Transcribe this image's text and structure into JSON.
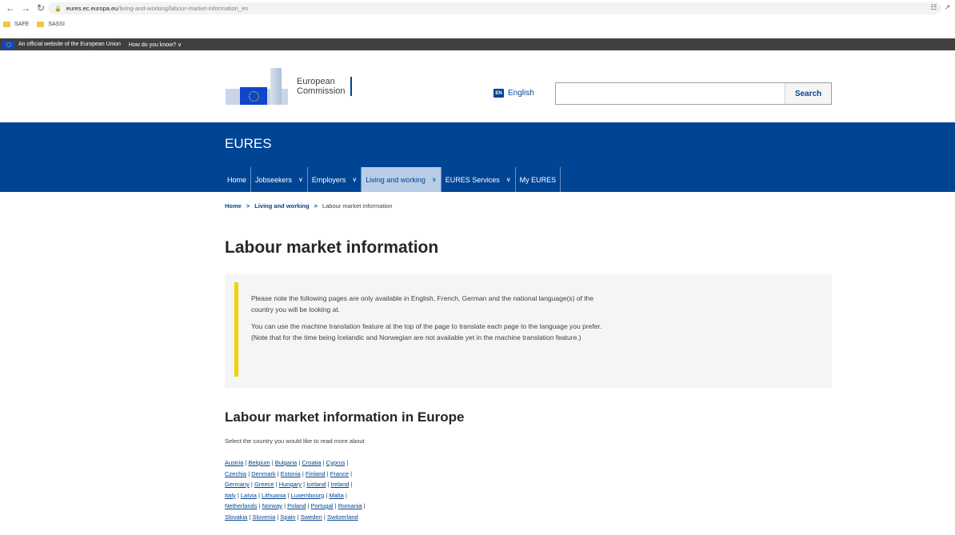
{
  "browser": {
    "url_host": "eures.ec.europa.eu",
    "url_path": "/living-and-working/labour-market-information_en",
    "bookmarks": [
      "SAFE",
      "SASSI"
    ]
  },
  "eu_bar": {
    "official_text": "An official website of the European Union",
    "how_know": "How do you know? ∨"
  },
  "header": {
    "logo_line1": "European",
    "logo_line2": "Commission",
    "lang_code": "EN",
    "lang_label": "English",
    "search_placeholder": "",
    "search_button": "Search"
  },
  "site": {
    "name": "EURES",
    "nav": [
      {
        "label": "Home",
        "dropdown": false
      },
      {
        "label": "Jobseekers",
        "dropdown": true
      },
      {
        "label": "Employers",
        "dropdown": true
      },
      {
        "label": "Living and working",
        "dropdown": true
      },
      {
        "label": "EURES Services",
        "dropdown": true
      },
      {
        "label": "My EURES",
        "dropdown": false
      }
    ]
  },
  "breadcrumb": {
    "home": "Home",
    "sep": ">",
    "parent": "Living and working",
    "current": "Labour market information"
  },
  "main": {
    "title": "Labour market information",
    "notice_p1": "Please note the following pages are only available in English, French, German and the national language(s) of the country you will be looking at.",
    "notice_p2": "You can use the machine translation feature at the top of the page to translate each page to the language you prefer. (Note that for the time being Icelandic and Norwegian are not available yet in the machine translation feature.)",
    "subtitle": "Labour market information in Europe",
    "intro": "Select the country you would like to read more about",
    "countries": [
      [
        "Austria",
        "Belgium",
        "Bulgaria",
        "Croatia",
        "Cyprus"
      ],
      [
        "Czechia",
        "Denmark",
        "Estonia",
        "Finland",
        "France"
      ],
      [
        "Germany",
        "Greece",
        "Hungary",
        "Iceland",
        "Ireland"
      ],
      [
        "Italy",
        "Latvia",
        "Lithuania",
        "Luxembourg",
        "Malta"
      ],
      [
        "Netherlands",
        "Norway",
        "Poland",
        "Portugal",
        "Romania"
      ],
      [
        "Slovakia",
        "Slovenia",
        "Spain",
        "Sweden",
        "Switzerland"
      ]
    ]
  },
  "icons": [
    "back-icon",
    "forward-icon",
    "reload-icon",
    "lock-icon",
    "translate-icon",
    "share-icon",
    "folder-icon",
    "eu-flag-icon"
  ],
  "colors": {
    "ec_blue": "#004494",
    "eu_bar": "#404040",
    "notice_accent": "#f3d103",
    "nav_active": "#b9cde6"
  }
}
